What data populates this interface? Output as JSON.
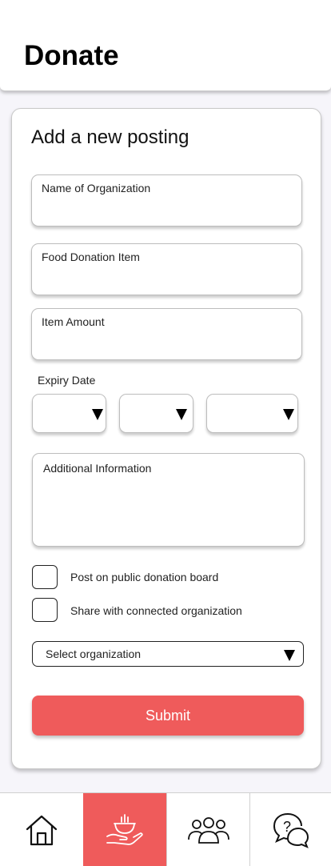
{
  "header": {
    "title": "Donate"
  },
  "form": {
    "title": "Add a new posting",
    "fields": {
      "organization_name": {
        "label": "Name of Organization",
        "value": ""
      },
      "food_item": {
        "label": "Food Donation Item",
        "value": ""
      },
      "item_amount": {
        "label": "Item Amount",
        "value": ""
      },
      "additional_info": {
        "label": "Additional Information",
        "value": ""
      }
    },
    "expiry": {
      "label": "Expiry Date",
      "month": "",
      "day": "",
      "year": ""
    },
    "options": {
      "public_board": {
        "label": "Post on public donation board",
        "checked": false
      },
      "share_connected": {
        "label": "Share with connected organization",
        "checked": false
      }
    },
    "organization_select": {
      "value": "Select organization"
    },
    "submit_label": "Submit"
  },
  "nav": {
    "items": [
      {
        "icon": "home-icon",
        "active": false
      },
      {
        "icon": "donate-icon",
        "active": true
      },
      {
        "icon": "community-icon",
        "active": false
      },
      {
        "icon": "help-chat-icon",
        "active": false
      }
    ]
  },
  "colors": {
    "accent": "#ef5b5b",
    "background": "#f6f5fa",
    "card": "#ffffff"
  }
}
